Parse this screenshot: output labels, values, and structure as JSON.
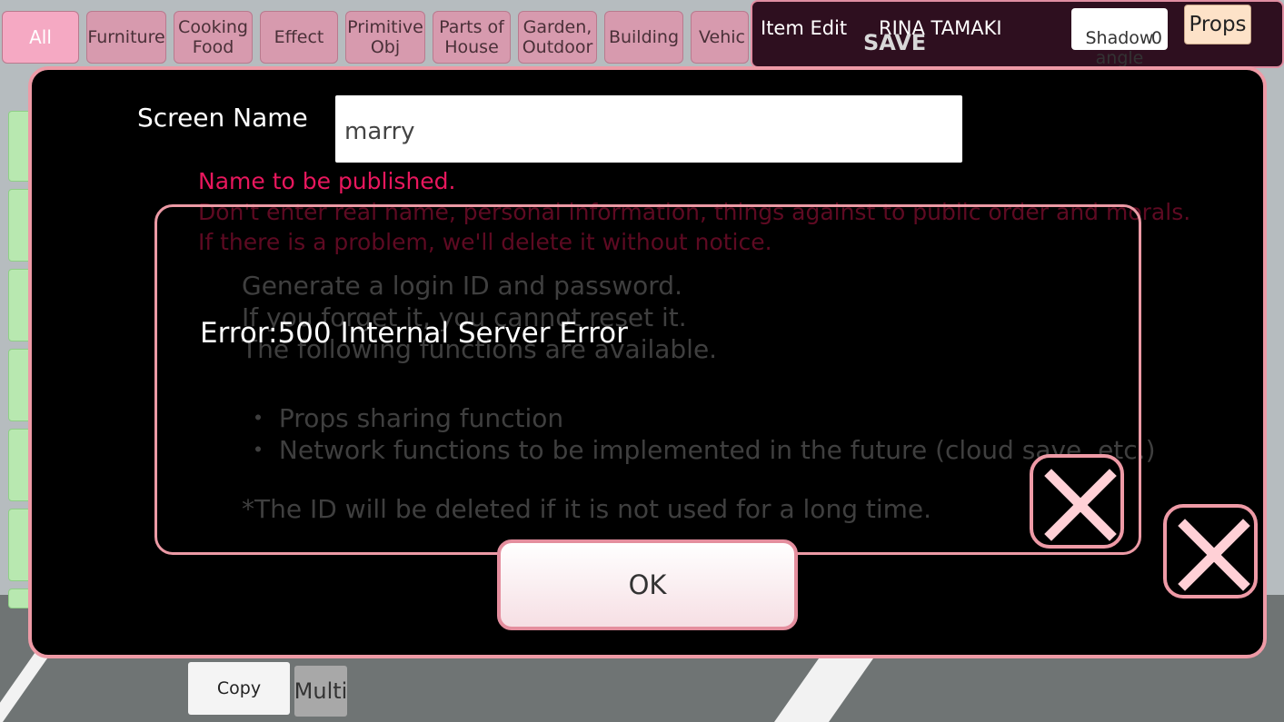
{
  "categories": [
    "All",
    "Furniture",
    "Cooking\nFood",
    "Effect",
    "Primitive\nObj",
    "Parts of\nHouse",
    "Garden,\nOutdoor",
    "Building",
    "Vehic"
  ],
  "top_panel": {
    "item_edit": "Item Edit",
    "character_name": "RINA TAMAKI",
    "save_label": "SAVE",
    "shadow_angle": "Shadow\nangle",
    "shadow_value": "0",
    "props_label": "Props"
  },
  "dialog": {
    "screen_name_label": "Screen Name",
    "screen_name_value": "marry",
    "notice_line1": "Name to be published.",
    "notice_line2": "Don't enter real name, personal information, things against to public order and morals.",
    "notice_line3": "If there is a problem, we'll delete it without notice.",
    "info_line1": "Generate a login ID and password.",
    "info_line2": "If you forget it, you cannot reset it.",
    "info_line3": "The following functions are available.",
    "info_bullet1": "・ Props sharing function",
    "info_bullet2": "・ Network functions to be implemented in the future (cloud save, etc.)",
    "info_note": "*The ID will be deleted if it is not used for a long time.",
    "error_message": "Error:500 Internal Server Error",
    "ok_label": "OK"
  },
  "bottom_bar": {
    "copy_label": "Copy",
    "multi_label": "Multi"
  },
  "colors": {
    "accent_pink": "#ee9aa6",
    "notice_red": "#e8175d",
    "dialog_bg": "#000000"
  }
}
